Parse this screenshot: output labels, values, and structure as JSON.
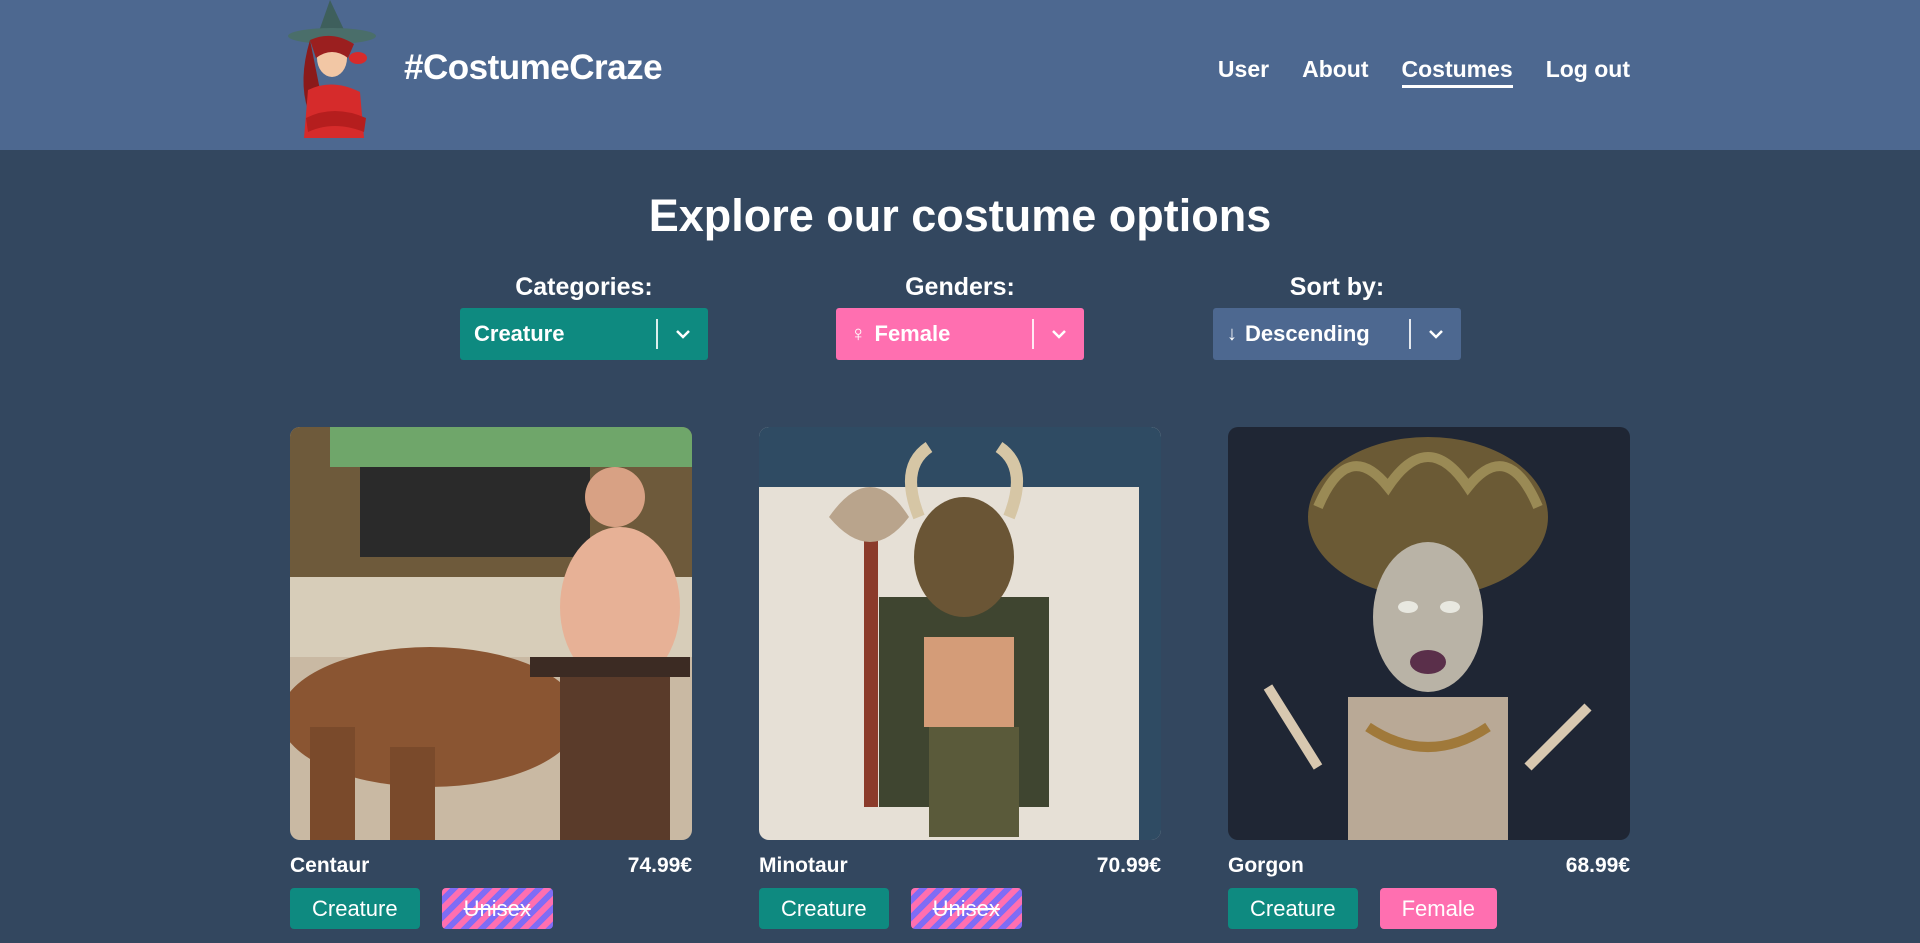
{
  "header": {
    "brand": "#CostumeCraze",
    "nav": [
      {
        "label": "User"
      },
      {
        "label": "About"
      },
      {
        "label": "Costumes",
        "active": true
      },
      {
        "label": "Log out"
      }
    ]
  },
  "main": {
    "title": "Explore our costume options",
    "filters": {
      "categories": {
        "label": "Categories:",
        "value": "Creature"
      },
      "genders": {
        "label": "Genders:",
        "value": "Female",
        "icon": "female-icon"
      },
      "sort": {
        "label": "Sort by:",
        "value": "Descending",
        "icon": "arrow-down-icon"
      }
    },
    "costumes": [
      {
        "name": "Centaur",
        "price": "74.99€",
        "tags": [
          "Creature",
          "Unisex"
        ]
      },
      {
        "name": "Minotaur",
        "price": "70.99€",
        "tags": [
          "Creature",
          "Unisex"
        ]
      },
      {
        "name": "Gorgon",
        "price": "68.99€",
        "tags": [
          "Creature",
          "Female"
        ]
      }
    ]
  },
  "colors": {
    "header_bg": "#4d6890",
    "page_bg": "#33475f",
    "teal": "#0e8a80",
    "pink": "#ff6fb0",
    "violet": "#7f6cf5"
  }
}
